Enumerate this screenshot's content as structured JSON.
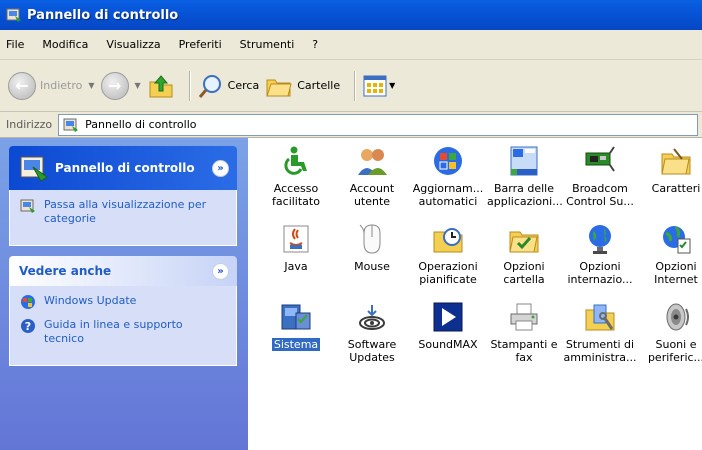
{
  "window": {
    "title": "Pannello di controllo"
  },
  "menu": [
    "File",
    "Modifica",
    "Visualizza",
    "Preferiti",
    "Strumenti",
    "?"
  ],
  "toolbar": {
    "back": "Indietro",
    "search": "Cerca",
    "folders": "Cartelle"
  },
  "address": {
    "label": "Indirizzo",
    "value": "Pannello di controllo"
  },
  "left": {
    "panel1": {
      "title": "Pannello di controllo",
      "link": "Passa alla visualizzazione per categorie"
    },
    "panel2": {
      "title": "Vedere anche",
      "links": [
        "Windows Update",
        "Guida in linea e supporto tecnico"
      ]
    }
  },
  "items": [
    {
      "label": "Accesso\nfacilitato",
      "icon": "accessibility-icon"
    },
    {
      "label": "Account\nutente",
      "icon": "user-accounts-icon"
    },
    {
      "label": "Aggiornam...\nautomatici",
      "icon": "automatic-updates-icon"
    },
    {
      "label": "Barra delle\napplicazioni...",
      "icon": "taskbar-icon"
    },
    {
      "label": "Broadcom\nControl Su...",
      "icon": "network-card-icon"
    },
    {
      "label": "Caratteri",
      "icon": "fonts-folder-icon"
    },
    {
      "label": "Java",
      "icon": "java-icon"
    },
    {
      "label": "Mouse",
      "icon": "mouse-icon"
    },
    {
      "label": "Operazioni\npianificate",
      "icon": "scheduled-tasks-icon"
    },
    {
      "label": "Opzioni\ncartella",
      "icon": "folder-options-icon"
    },
    {
      "label": "Opzioni\ninternazio...",
      "icon": "globe-icon"
    },
    {
      "label": "Opzioni\nInternet",
      "icon": "internet-options-icon"
    },
    {
      "label": "Sistema",
      "icon": "system-icon",
      "selected": true
    },
    {
      "label": "Software\nUpdates",
      "icon": "software-updates-icon"
    },
    {
      "label": "SoundMAX",
      "icon": "soundmax-icon"
    },
    {
      "label": "Stampanti e\nfax",
      "icon": "printer-icon"
    },
    {
      "label": "Strumenti di\namministra...",
      "icon": "admin-tools-icon"
    },
    {
      "label": "Suoni e\nperiferic...",
      "icon": "speaker-icon"
    }
  ],
  "colors": {
    "titlebar": "#0753d6",
    "selection": "#316ac5",
    "link": "#215dc6"
  }
}
